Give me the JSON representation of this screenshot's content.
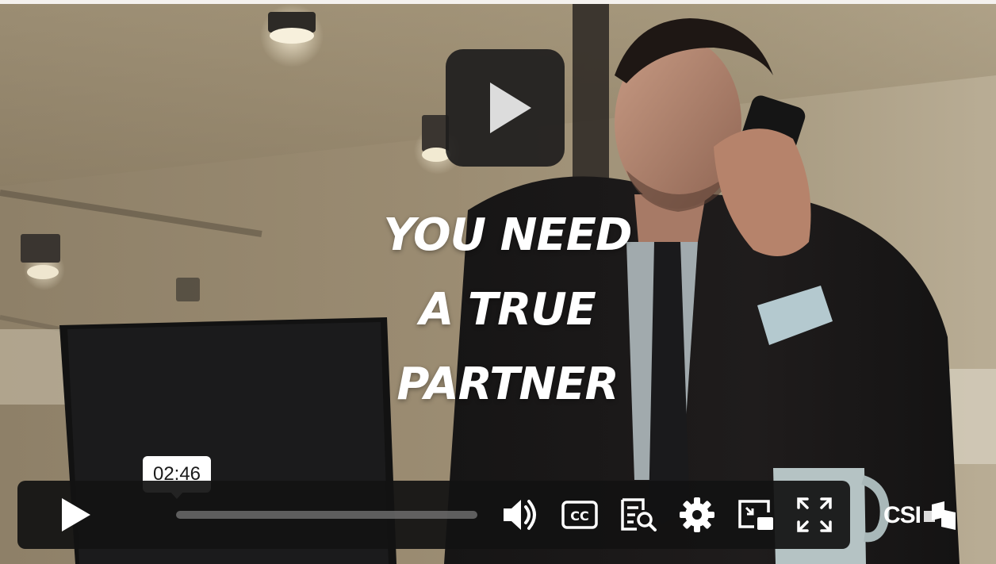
{
  "video": {
    "headline_lines": [
      "YOU NEED",
      "A TRUE",
      "PARTNER"
    ],
    "hover_time": "02:46",
    "progress": 0.0
  },
  "controls": {
    "items": [
      {
        "name": "play-button",
        "icon": "play-icon"
      },
      {
        "name": "volume-button",
        "icon": "volume-icon"
      },
      {
        "name": "captions-button",
        "icon": "cc-icon",
        "label": "CC"
      },
      {
        "name": "transcript-button",
        "icon": "transcript-search-icon"
      },
      {
        "name": "settings-button",
        "icon": "gear-icon"
      },
      {
        "name": "picture-in-picture-button",
        "icon": "pip-icon"
      },
      {
        "name": "fullscreen-button",
        "icon": "fullscreen-icon"
      }
    ]
  },
  "brand": {
    "text": "CSI",
    "icon": "csi-logo-mark"
  },
  "colors": {
    "control_bar": "#121212",
    "icon": "#ffffff",
    "tooltip": "#ffffff"
  }
}
